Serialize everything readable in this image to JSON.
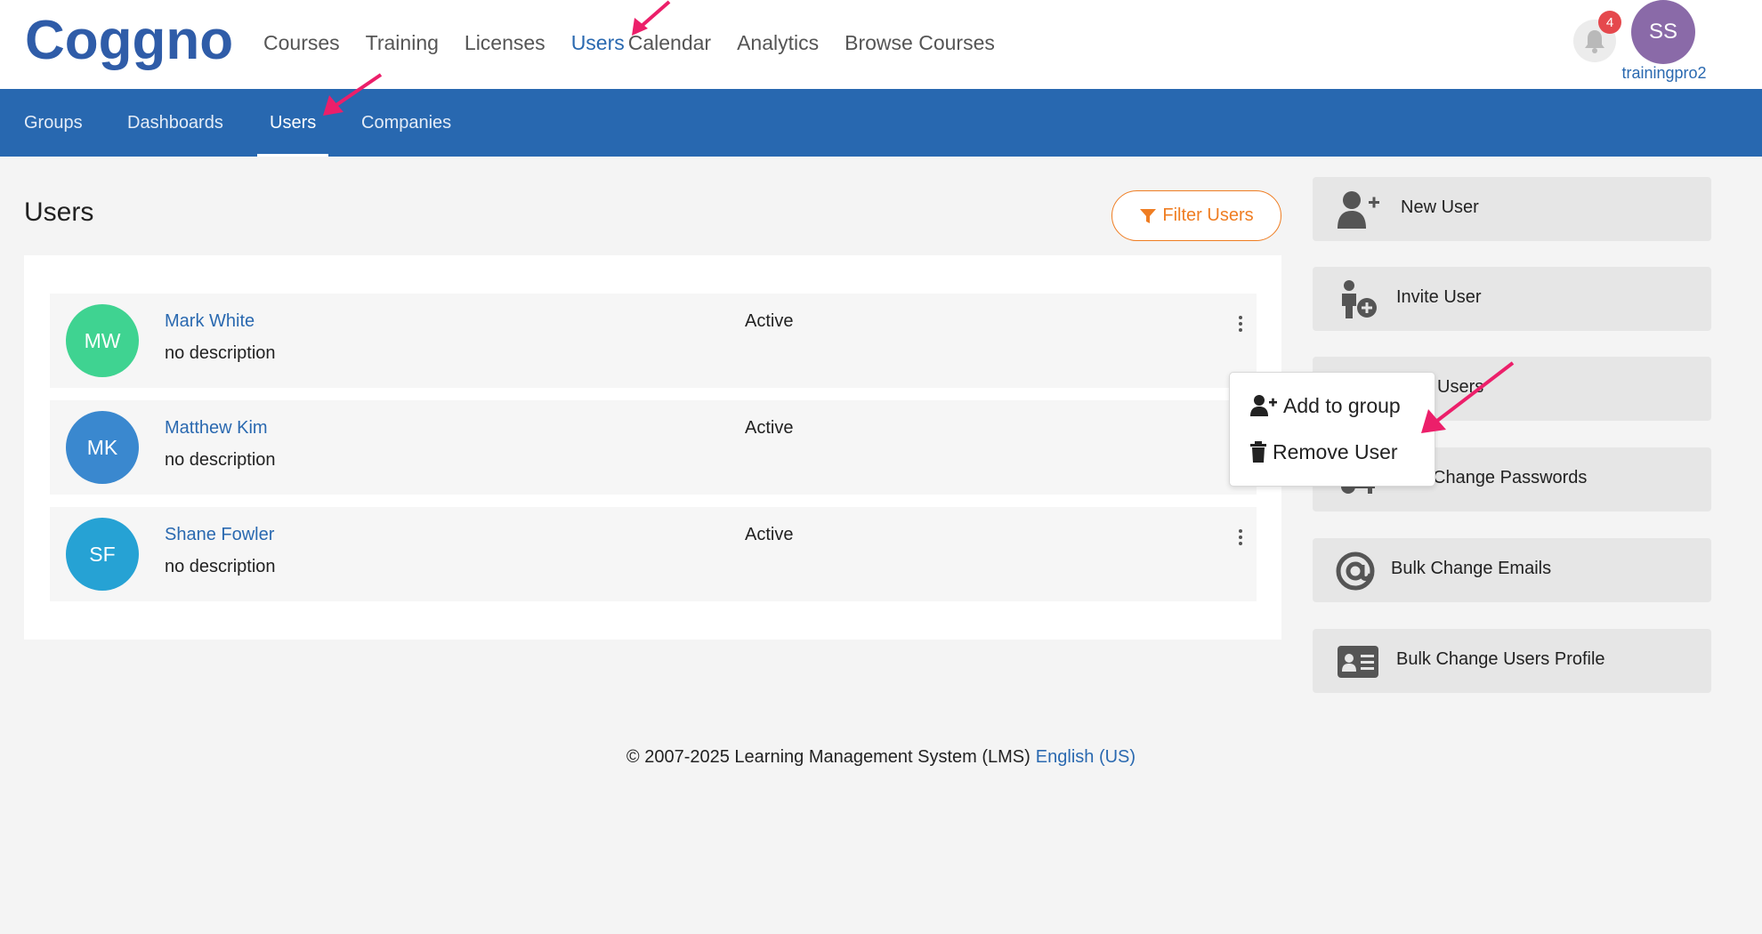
{
  "app": {
    "logo_text": "Coggno"
  },
  "top_nav": {
    "items": [
      {
        "label": "Courses"
      },
      {
        "label": "Training"
      },
      {
        "label": "Licenses"
      },
      {
        "label": "Users"
      },
      {
        "label": "Calendar"
      },
      {
        "label": "Analytics"
      },
      {
        "label": "Browse Courses"
      }
    ],
    "active": "Users"
  },
  "header": {
    "notification_count": "4",
    "avatar_initials": "SS",
    "username": "trainingpro2"
  },
  "sub_nav": {
    "items": [
      {
        "label": "Groups"
      },
      {
        "label": "Dashboards"
      },
      {
        "label": "Users"
      },
      {
        "label": "Companies"
      }
    ],
    "active": "Users"
  },
  "main": {
    "title": "Users",
    "filter_button": "Filter Users",
    "users": [
      {
        "initials": "MW",
        "name": "Mark White",
        "description": "no description",
        "status": "Active",
        "avatar_color": "#3fd391"
      },
      {
        "initials": "MK",
        "name": "Matthew Kim",
        "description": "no description",
        "status": "Active",
        "avatar_color": "#3a88cf"
      },
      {
        "initials": "SF",
        "name": "Shane Fowler",
        "description": "no description",
        "status": "Active",
        "avatar_color": "#26a2d4"
      }
    ]
  },
  "actions": [
    {
      "label": "New User",
      "icon": "user-plus-icon"
    },
    {
      "label": "Invite User",
      "icon": "invite-user-icon"
    },
    {
      "label": "Users",
      "icon": "users-icon"
    },
    {
      "label": "Change Passwords",
      "icon": "key-icon"
    },
    {
      "label": "Bulk Change Emails",
      "icon": "at-icon"
    },
    {
      "label": "Bulk Change Users Profile",
      "icon": "id-card-icon"
    }
  ],
  "dropdown": {
    "items": [
      {
        "label": "Add to group",
        "icon": "user-plus-icon"
      },
      {
        "label": "Remove User",
        "icon": "trash-icon"
      }
    ]
  },
  "footer": {
    "copyright": "© 2007-2025 Learning Management System (LMS)",
    "language": "English (US)"
  },
  "colors": {
    "brand_blue": "#2868b0",
    "link_blue": "#2a69b0",
    "filter_orange": "#ef7d22",
    "annotation_pink": "#ec1f6a",
    "badge_red": "#e5484d"
  }
}
